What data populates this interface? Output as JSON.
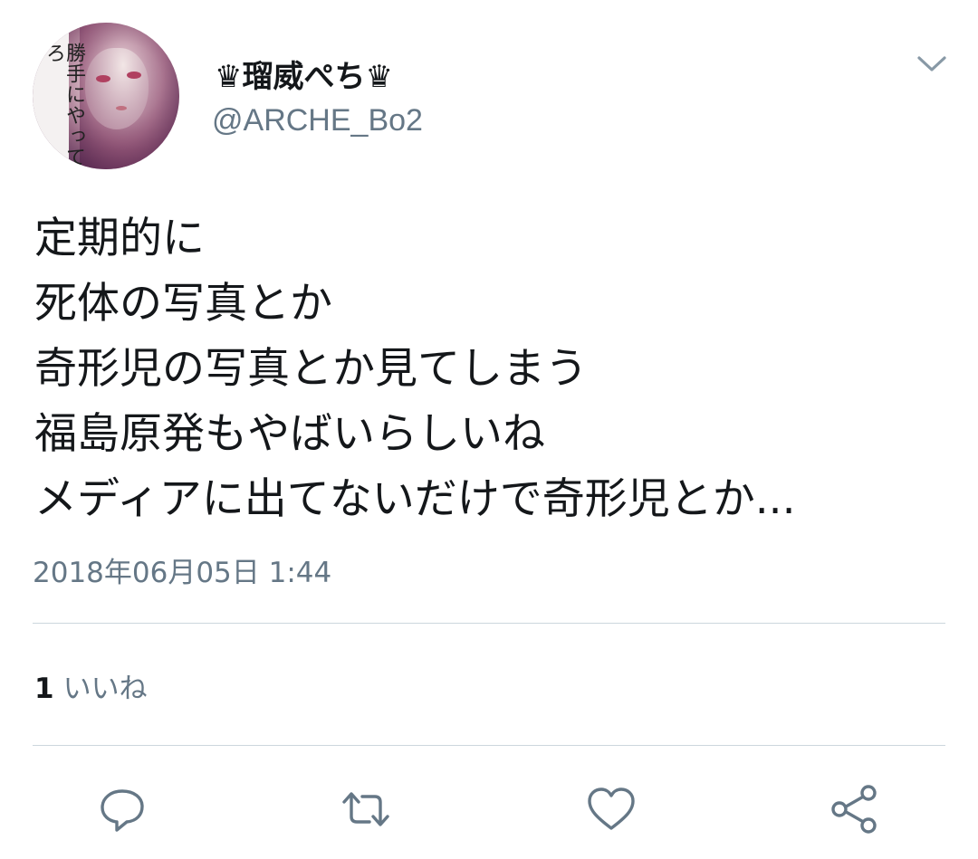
{
  "tweet": {
    "display_name": "♛瑠威ぺち♛",
    "handle": "@ARCHE_Bo2",
    "avatar_text": "勝手にやってろ",
    "text_lines": [
      "定期的に",
      "死体の写真とか",
      "奇形児の写真とか見てしまう",
      "福島原発もやばいらしいね",
      "メディアに出てないだけで奇形児とか..."
    ],
    "timestamp": "2018年06月05日 1:44"
  },
  "stats": {
    "like_count": "1",
    "like_label": "いいね"
  },
  "actions": [
    {
      "icon": "reply-icon"
    },
    {
      "icon": "retweet-icon"
    },
    {
      "icon": "like-icon"
    },
    {
      "icon": "share-icon"
    }
  ],
  "colors": {
    "text_primary": "#14171a",
    "text_secondary": "#657786",
    "divider": "#ccd6dd"
  }
}
